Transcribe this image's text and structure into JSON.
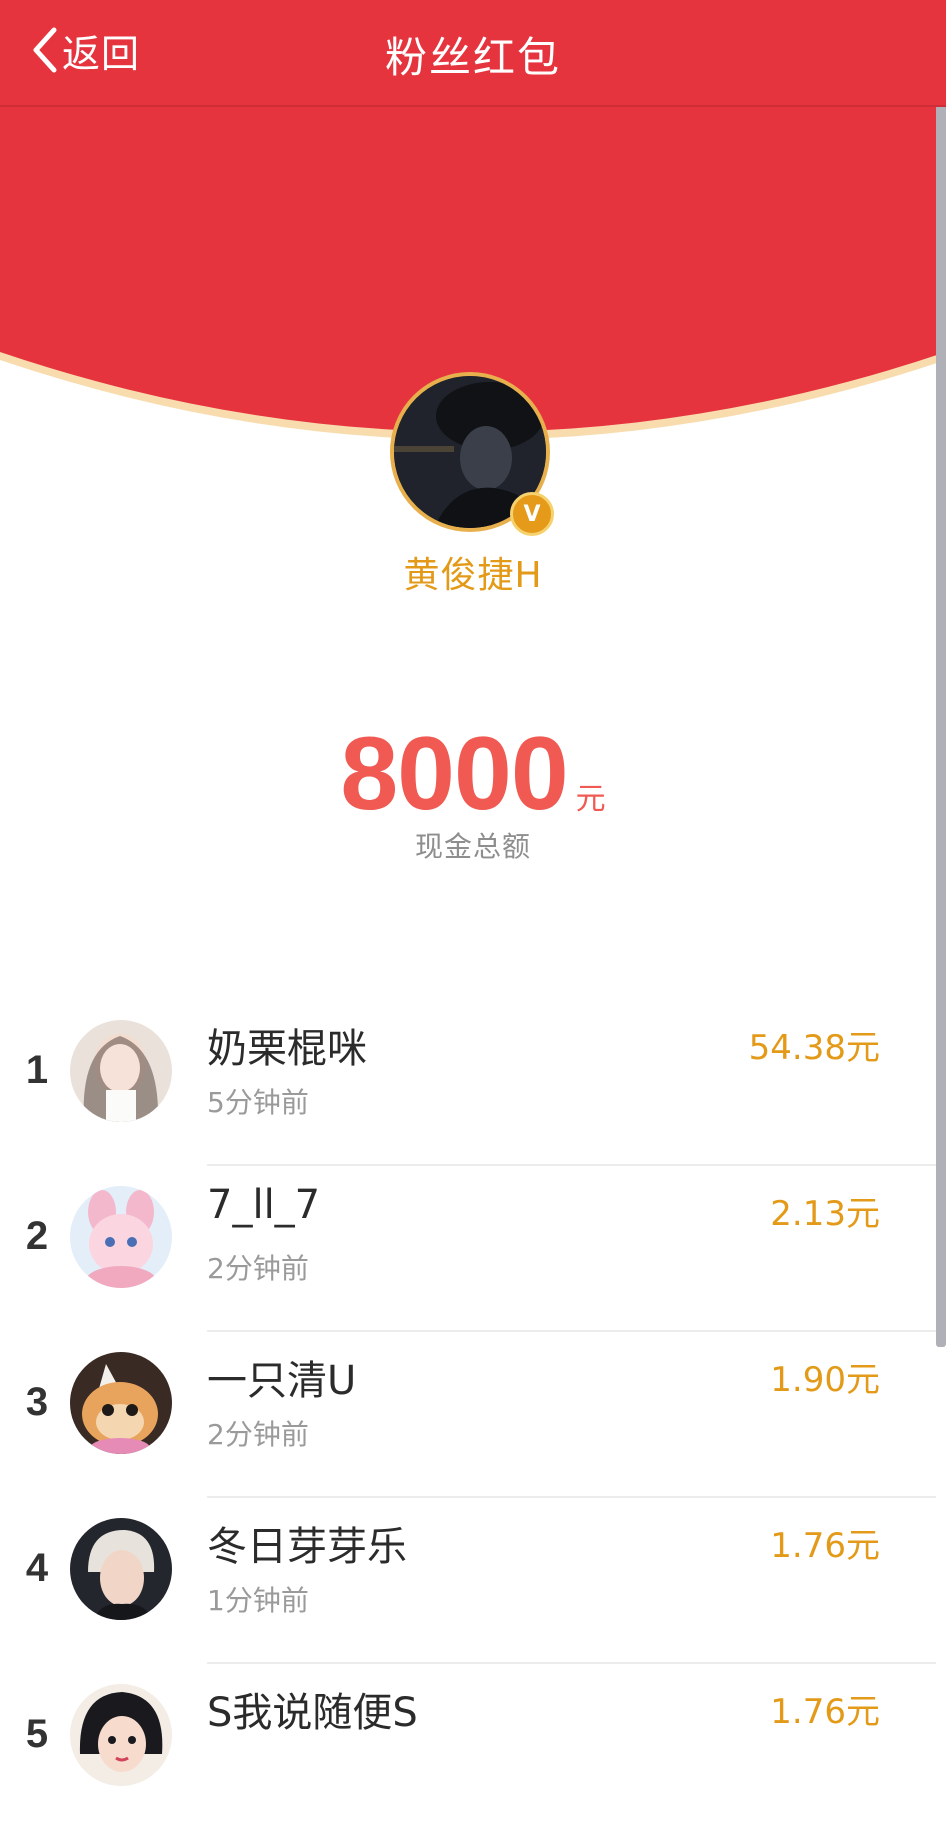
{
  "navbar": {
    "back_label": "返回",
    "title": "粉丝红包"
  },
  "colors": {
    "header_red": "#e6343f",
    "accent_gold": "#e39a18",
    "amount_red": "#f05a52"
  },
  "sender": {
    "name": "黄俊捷H",
    "verified_mark": "V"
  },
  "total": {
    "amount": "8000",
    "unit": "元",
    "label": "现金总额"
  },
  "recipients": [
    {
      "rank": "1",
      "name": "奶栗棍咪",
      "time": "5分钟前",
      "amount": "54.38元"
    },
    {
      "rank": "2",
      "name": "7_ll_7",
      "time": "2分钟前",
      "amount": "2.13元"
    },
    {
      "rank": "3",
      "name": "一只清U",
      "time": "2分钟前",
      "amount": "1.90元"
    },
    {
      "rank": "4",
      "name": "冬日芽芽乐",
      "time": "1分钟前",
      "amount": "1.76元"
    },
    {
      "rank": "5",
      "name": "S我说随便S",
      "time": "",
      "amount": "1.76元"
    }
  ]
}
